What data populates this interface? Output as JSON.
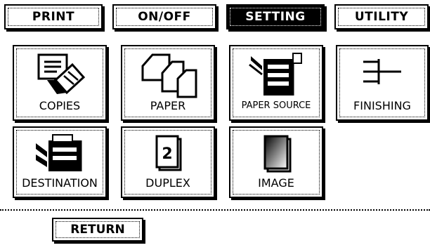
{
  "tabs": [
    {
      "label": "PRINT",
      "active": false
    },
    {
      "label": "ON/OFF",
      "active": false
    },
    {
      "label": "SETTING",
      "active": true
    },
    {
      "label": "UTILITY",
      "active": false
    }
  ],
  "functions": [
    {
      "label": "COPIES",
      "icon": "copies-icon"
    },
    {
      "label": "PAPER",
      "icon": "paper-icon"
    },
    {
      "label": "PAPER SOURCE",
      "icon": "paper-source-icon"
    },
    {
      "label": "FINISHING",
      "icon": "finishing-icon"
    },
    {
      "label": "DESTINATION",
      "icon": "destination-icon"
    },
    {
      "label": "DUPLEX",
      "icon": "duplex-icon"
    },
    {
      "label": "IMAGE",
      "icon": "image-icon"
    }
  ],
  "duplex_icon_text": "2",
  "return_label": "RETURN"
}
